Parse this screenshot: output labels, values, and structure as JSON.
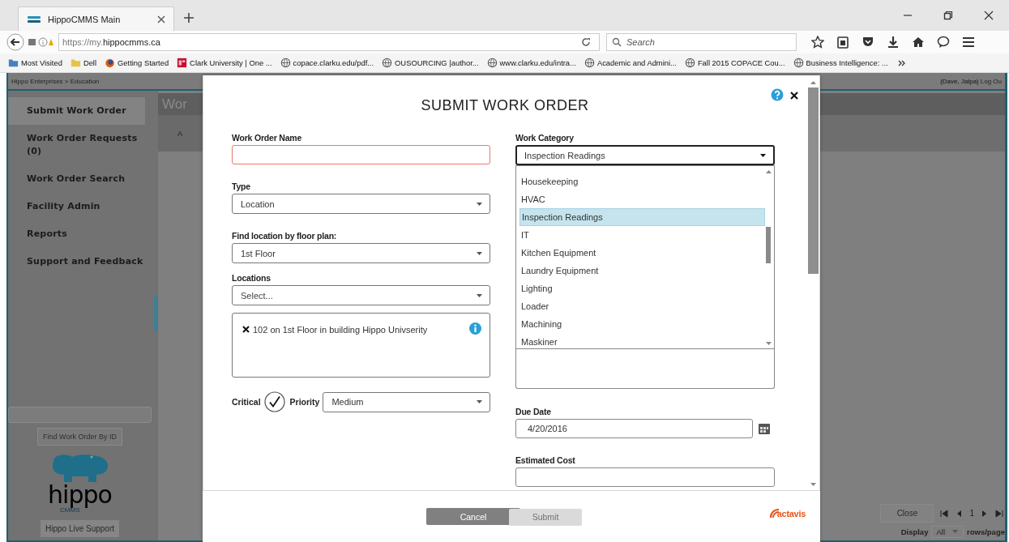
{
  "browser": {
    "tab": {
      "title": "HippoCMMS Main"
    },
    "address": "https://my.**hippocmms.ca**",
    "search": {
      "placeholder": "Search"
    },
    "bookmarks": [
      {
        "label": "Most Visited",
        "kind": "folder-blue"
      },
      {
        "label": "Dell",
        "kind": "folder"
      },
      {
        "label": "Getting Started",
        "kind": "firefox"
      },
      {
        "label": "Clark University | One ...",
        "kind": "red"
      },
      {
        "label": "copace.clarku.edu/pdf...",
        "kind": "globe"
      },
      {
        "label": "OUSOURCING |author...",
        "kind": "globe"
      },
      {
        "label": "www.clarku.edu/intra...",
        "kind": "globe"
      },
      {
        "label": "Academic and Admini...",
        "kind": "globe"
      },
      {
        "label": "Fall 2015 COPACE Cou...",
        "kind": "globe"
      },
      {
        "label": "Business Intelligence: ...",
        "kind": "globe"
      }
    ]
  },
  "app": {
    "breadcrumb": "Hippo Enterprises > Education",
    "user": "(Dave, Jalpa)",
    "logout": "Log Ou",
    "sidebar": {
      "items": [
        {
          "label": "Submit Work Order",
          "selected": true
        },
        {
          "label": "Work Order Requests (0)",
          "selected": false
        },
        {
          "label": "Work Order Search",
          "selected": false
        },
        {
          "label": "Facility Admin",
          "selected": false
        },
        {
          "label": "Reports",
          "selected": false
        },
        {
          "label": "Support and Feedback",
          "selected": false
        }
      ],
      "find_button": "Find Work Order By ID",
      "logo": {
        "name": "hippo",
        "sub": "CMMS"
      },
      "live_support": "Hippo Live Support"
    },
    "main": {
      "title": "Wor",
      "tab": "A",
      "close_button": "Close",
      "page": "1",
      "display_label": "Display",
      "display_value": "All",
      "rows_label": "rows/page"
    }
  },
  "dialog": {
    "title": "SUBMIT WORK ORDER",
    "left_fields": [
      {
        "kind": "text",
        "label": "Work Order Name",
        "invalid": true
      },
      {
        "kind": "select",
        "label": "Type",
        "value": "Location"
      },
      {
        "kind": "select",
        "label": "Find location by floor plan:",
        "value": "1st Floor"
      },
      {
        "kind": "select",
        "label": "Locations",
        "placeholder": "Select..."
      },
      {
        "kind": "tags",
        "tags": [
          "102 on 1st Floor in building Hippo Univserity"
        ]
      }
    ],
    "critical": {
      "label": "Critical",
      "checked": true
    },
    "priority": {
      "label": "Priority",
      "value": "Medium"
    },
    "work_category": {
      "label": "Work Category",
      "value": "Inspection Readings",
      "expanded": true,
      "options": [
        {
          "label": "Housekeeping",
          "selected": false
        },
        {
          "label": "HVAC",
          "selected": false
        },
        {
          "label": "Inspection Readings",
          "selected": true
        },
        {
          "label": "IT",
          "selected": false
        },
        {
          "label": "Kitchen Equipment",
          "selected": false
        },
        {
          "label": "Laundry Equipment",
          "selected": false
        },
        {
          "label": "Lighting",
          "selected": false
        },
        {
          "label": "Loader",
          "selected": false
        },
        {
          "label": "Machining",
          "selected": false
        },
        {
          "label": "Maskiner",
          "selected": false
        }
      ]
    },
    "due_date": {
      "label": "Due Date",
      "value": "4/20/2016"
    },
    "estimated_cost": {
      "label": "Estimated Cost"
    },
    "buttons": [
      {
        "label": "Cancel",
        "disabled": false
      },
      {
        "label": "Submit",
        "disabled": true
      }
    ],
    "brand": "actavis"
  }
}
